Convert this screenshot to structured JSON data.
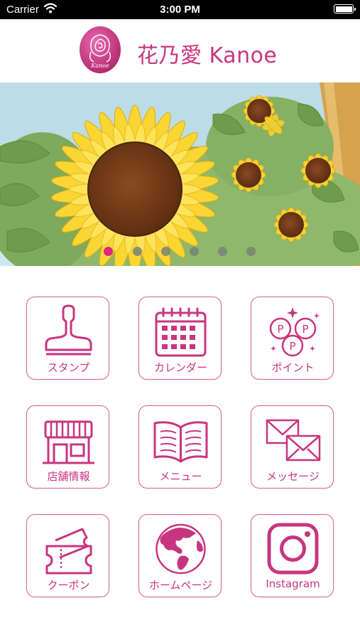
{
  "status_bar": {
    "carrier": "Carrier",
    "time": "3:00 PM"
  },
  "header": {
    "brand": "花乃愛 Kanoe",
    "logo_text": "Kanoe"
  },
  "carousel": {
    "slide_count": 6,
    "active_index": 0
  },
  "menu": [
    {
      "label": "スタンプ",
      "icon": "stamp-icon"
    },
    {
      "label": "カレンダー",
      "icon": "calendar-icon"
    },
    {
      "label": "ポイント",
      "icon": "points-icon"
    },
    {
      "label": "店舗情報",
      "icon": "store-icon"
    },
    {
      "label": "メニュー",
      "icon": "book-icon"
    },
    {
      "label": "メッセージ",
      "icon": "envelope-icon"
    },
    {
      "label": "クーポン",
      "icon": "coupon-icon"
    },
    {
      "label": "ホームページ",
      "icon": "globe-icon"
    },
    {
      "label": "Instagram",
      "icon": "instagram-icon"
    }
  ],
  "colors": {
    "accent": "#c8357f",
    "tile_border": "#d55a92",
    "active_dot": "#e0277f"
  }
}
